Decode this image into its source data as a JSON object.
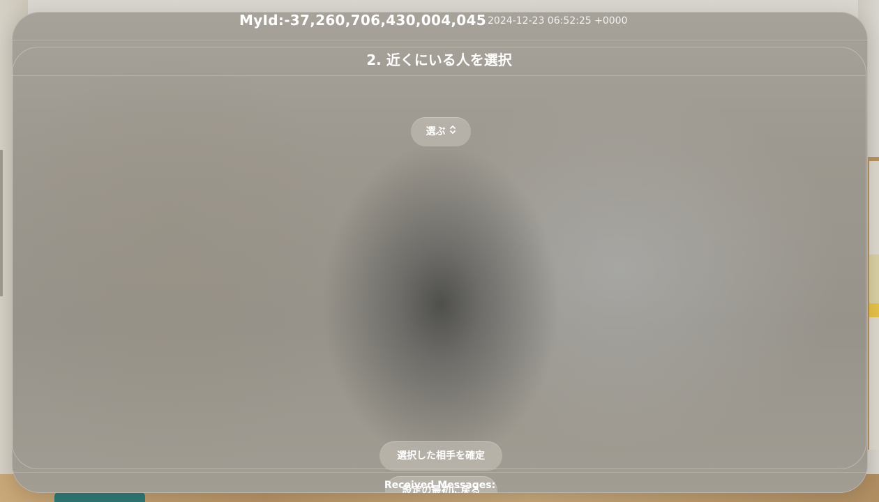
{
  "header": {
    "my_id": "MyId:-37,260,706,430,004,045",
    "timestamp": "2024-12-23 06:52:25 +0000"
  },
  "panel": {
    "title": "2. 近くにいる人を選択",
    "picker_label": "選ぶ",
    "picker_icon": "chevron-up-down-icon"
  },
  "actions": {
    "confirm_label": "選択した相手を確定",
    "reset_label": "設定の最初に戻る"
  },
  "messages": {
    "heading": "Received Messages:"
  },
  "colors": {
    "text": "#ffffff",
    "glass": "#9d988f",
    "button": "#c8c4bc"
  }
}
